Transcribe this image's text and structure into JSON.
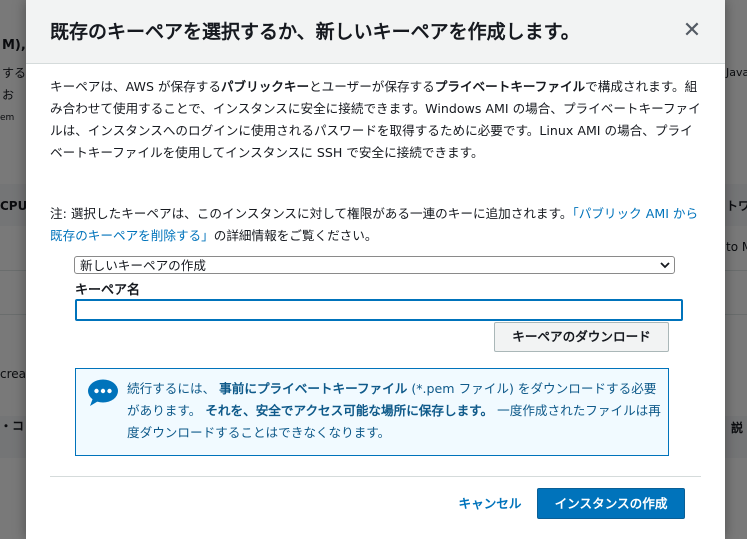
{
  "background": {
    "fragments": [
      "M),",
      "する",
      "お",
      "em",
      "CPU",
      "creat",
      "・コ",
      "Java",
      "トワ",
      "to M",
      "説"
    ]
  },
  "modal": {
    "title": "既存のキーペアを選択するか、新しいキーペアを作成します。",
    "close_icon": "close-icon",
    "intro": {
      "part1": "キーペアは、AWS が保存する",
      "bold1": "パブリックキー",
      "part2": "とユーザーが保存する",
      "bold2": "プライベートキーファイル",
      "part3": "で構成されます。組み合わせて使用することで、インスタンスに安全に接続できます。Windows AMI の場合、プライベートキーファイルは、インスタンスへのログインに使用されるパスワードを取得するために必要です。Linux AMI の場合、プライベートキーファイルを使用してインスタンスに SSH で安全に接続できます。"
    },
    "note": {
      "prefix": "注: 選択したキーペアは、このインスタンスに対して権限がある一連のキーに追加されます。",
      "link": "「パブリック AMI から既存のキーペアを削除する」",
      "suffix": "の詳細情報をご覧ください。"
    },
    "select": {
      "value": "新しいキーペアの作成"
    },
    "key_name": {
      "label": "キーペア名",
      "value": "",
      "placeholder": ""
    },
    "download_label": "キーペアのダウンロード",
    "alert": {
      "icon": "chat-bubble-icon",
      "t1": "続行するには、",
      "b1": "事前にプライベートキーファイル",
      "t2": "(*.pem ファイル) をダウンロードする必要があります。",
      "b2": "それを、安全でアクセス可能な場所に保存します。",
      "t3": "一度作成されたファイルは再度ダウンロードすることはできなくなります。"
    },
    "cancel_label": "キャンセル",
    "create_label": "インスタンスの作成"
  },
  "colors": {
    "accent": "#0073bb",
    "alert_bg": "#f1faff",
    "header_bg": "#f2f3f3"
  }
}
